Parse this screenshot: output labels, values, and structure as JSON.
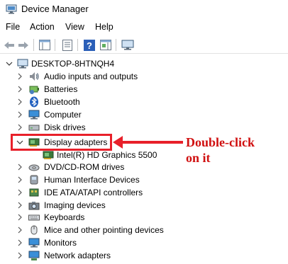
{
  "window": {
    "title": "Device Manager",
    "icon": "device-manager-icon"
  },
  "menu": {
    "items": [
      "File",
      "Action",
      "View",
      "Help"
    ]
  },
  "toolbar": {
    "buttons": [
      "back-arrow-icon",
      "forward-arrow-icon",
      "show-hide-console-tree-icon",
      "properties-icon",
      "help-icon",
      "action-pane-icon",
      "monitor-icon"
    ]
  },
  "tree": {
    "root": {
      "label": "DESKTOP-8HTNQH4",
      "icon": "computer-icon",
      "expanded": true
    },
    "items": [
      {
        "label": "Audio inputs and outputs",
        "icon": "speaker-icon",
        "expanded": false
      },
      {
        "label": "Batteries",
        "icon": "battery-icon",
        "expanded": false
      },
      {
        "label": "Bluetooth",
        "icon": "bluetooth-icon",
        "expanded": false
      },
      {
        "label": "Computer",
        "icon": "computer-icon",
        "expanded": false
      },
      {
        "label": "Disk drives",
        "icon": "disk-drive-icon",
        "expanded": false
      },
      {
        "label": "Display adapters",
        "icon": "display-adapter-icon",
        "expanded": true,
        "selected": true
      },
      {
        "label": "Intel(R) HD Graphics 5500",
        "icon": "display-adapter-icon",
        "child": true
      },
      {
        "label": "DVD/CD-ROM drives",
        "icon": "dvd-icon",
        "expanded": false
      },
      {
        "label": "Human Interface Devices",
        "icon": "hid-icon",
        "expanded": false
      },
      {
        "label": "IDE ATA/ATAPI controllers",
        "icon": "ide-controller-icon",
        "expanded": false
      },
      {
        "label": "Imaging devices",
        "icon": "camera-icon",
        "expanded": false
      },
      {
        "label": "Keyboards",
        "icon": "keyboard-icon",
        "expanded": false
      },
      {
        "label": "Mice and other pointing devices",
        "icon": "mouse-icon",
        "expanded": false
      },
      {
        "label": "Monitors",
        "icon": "monitor-icon",
        "expanded": false
      },
      {
        "label": "Network adapters",
        "icon": "network-adapter-icon",
        "expanded": false
      }
    ]
  },
  "annotation": {
    "line1": "Double-click",
    "line2": "on it",
    "color": "#d01010"
  }
}
